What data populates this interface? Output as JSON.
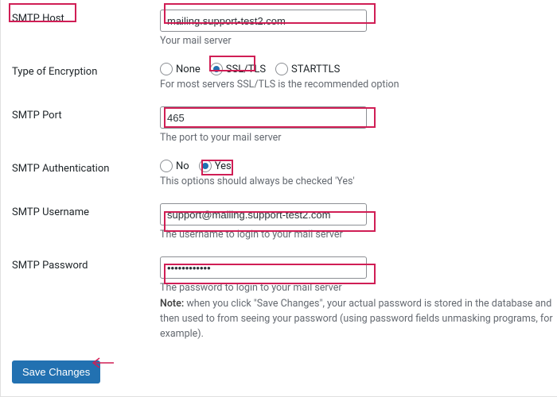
{
  "fields": {
    "smtp_host": {
      "label": "SMTP Host",
      "value": "mailing.support-test2.com",
      "hint": "Your mail server"
    },
    "encryption": {
      "label": "Type of Encryption",
      "options": {
        "none": "None",
        "ssltls": "SSL/TLS",
        "starttls": "STARTTLS"
      },
      "selected": "ssltls",
      "hint": "For most servers SSL/TLS is the recommended option"
    },
    "smtp_port": {
      "label": "SMTP Port",
      "value": "465",
      "hint": "The port to your mail server"
    },
    "smtp_auth": {
      "label": "SMTP Authentication",
      "options": {
        "no": "No",
        "yes": "Yes"
      },
      "selected": "yes",
      "hint": "This options should always be checked 'Yes'"
    },
    "smtp_user": {
      "label": "SMTP Username",
      "value": "support@mailing.support-test2.com",
      "hint": "The username to login to your mail server"
    },
    "smtp_pass": {
      "label": "SMTP Password",
      "value": "••••••••••••",
      "hint": "The password to login to your mail server",
      "note_bold": "Note:",
      "note_rest": " when you click \"Save Changes\", your actual password is stored in the database and then used to from seeing your password (using password fields unmasking programs, for example)."
    }
  },
  "buttons": {
    "save": "Save Changes"
  }
}
